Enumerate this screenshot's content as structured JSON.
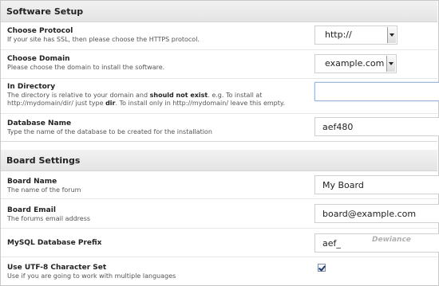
{
  "software_setup": {
    "title": "Software Setup",
    "protocol": {
      "label": "Choose Protocol",
      "desc": "If your site has SSL, then please choose the HTTPS protocol.",
      "value": "http://"
    },
    "domain": {
      "label": "Choose Domain",
      "desc": "Please choose the domain to install the software.",
      "value": "example.com"
    },
    "directory": {
      "label": "In Directory",
      "desc_1": "The directory is relative to your domain and ",
      "desc_bold_1": "should not exist",
      "desc_2": ". e.g. To install at",
      "desc_3": "http://mydomain/dir/ just type ",
      "desc_bold_2": "dir",
      "desc_4": ". To install only in http://mydomain/ leave this empty.",
      "value": ""
    },
    "database": {
      "label": "Database Name",
      "desc": "Type the name of the database to be created for the installation",
      "value": "aef480"
    }
  },
  "board_settings": {
    "title": "Board Settings",
    "board_name": {
      "label": "Board Name",
      "desc": "The name of the forum",
      "value": "My Board"
    },
    "board_email": {
      "label": "Board Email",
      "desc": "The forums email address",
      "value": "board@example.com"
    },
    "db_prefix": {
      "label": "MySQL Database Prefix",
      "value": "aef_",
      "watermark": "Dewiance"
    },
    "utf8": {
      "label": "Use UTF-8 Character Set",
      "desc": "Use if you are going to work with multiple languages",
      "checked": true
    }
  }
}
